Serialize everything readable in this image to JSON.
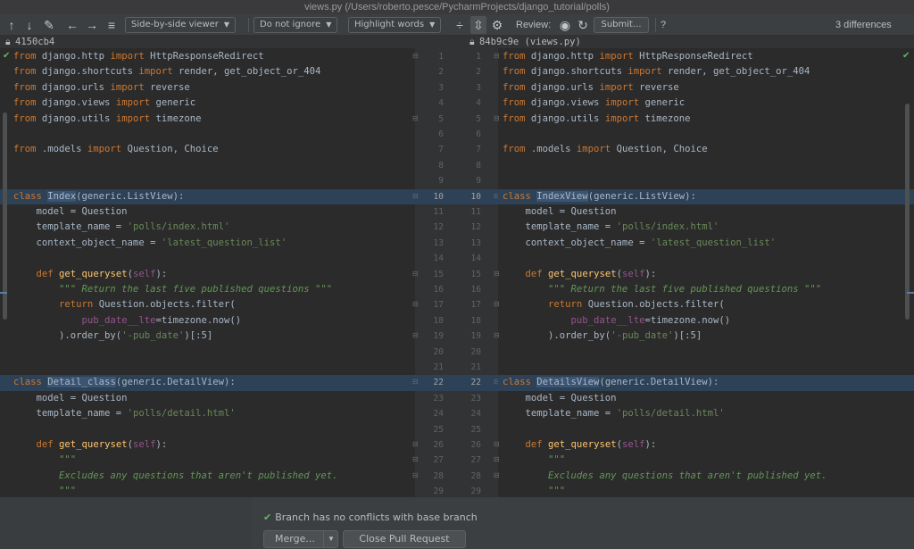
{
  "window": {
    "title": "views.py (/Users/roberto.pesce/PycharmProjects/django_tutorial/polls)"
  },
  "toolbar": {
    "viewer": "Side-by-side viewer",
    "ignore": "Do not ignore",
    "highlight": "Highlight words",
    "review_label": "Review:",
    "submit_label": "Submit...",
    "help": "?",
    "differences": "3 differences"
  },
  "revisions": {
    "left": "4150cb4",
    "right": "84b9c9e (views.py)"
  },
  "bottom": {
    "status": "Branch has no conflicts with base branch",
    "merge_label": "Merge...",
    "close_label": "Close Pull Request"
  },
  "lines_left": [
    "from django.http import HttpResponseRedirect",
    "from django.shortcuts import render, get_object_or_404",
    "from django.urls import reverse",
    "from django.views import generic",
    "from django.utils import timezone",
    "",
    "from .models import Question, Choice",
    "",
    "",
    "class Index(generic.ListView):",
    "    model = Question",
    "    template_name = 'polls/index.html'",
    "    context_object_name = 'latest_question_list'",
    "",
    "    def get_queryset(self):",
    "        \"\"\" Return the last five published questions \"\"\"",
    "        return Question.objects.filter(",
    "            pub_date__lte=timezone.now()",
    "        ).order_by('-pub_date')[:5]",
    "",
    "",
    "class Detail_class(generic.DetailView):",
    "    model = Question",
    "    template_name = 'polls/detail.html'",
    "",
    "    def get_queryset(self):",
    "        \"\"\"",
    "        Excludes any questions that aren't published yet.",
    "        \"\"\""
  ],
  "lines_right": [
    "from django.http import HttpResponseRedirect",
    "from django.shortcuts import render, get_object_or_404",
    "from django.urls import reverse",
    "from django.views import generic",
    "from django.utils import timezone",
    "",
    "from .models import Question, Choice",
    "",
    "",
    "class IndexView(generic.ListView):",
    "    model = Question",
    "    template_name = 'polls/index.html'",
    "    context_object_name = 'latest_question_list'",
    "",
    "    def get_queryset(self):",
    "        \"\"\" Return the last five published questions \"\"\"",
    "        return Question.objects.filter(",
    "            pub_date__lte=timezone.now()",
    "        ).order_by('-pub_date')[:5]",
    "",
    "",
    "class DetailsView(generic.DetailView):",
    "    model = Question",
    "    template_name = 'polls/detail.html'",
    "",
    "    def get_queryset(self):",
    "        \"\"\"",
    "        Excludes any questions that aren't published yet.",
    "        \"\"\""
  ],
  "changed_lines": [
    10,
    22
  ],
  "colors": {
    "changed_bg": "#2d4157",
    "keyword": "#cc7832",
    "string": "#6a8759",
    "docstring": "#629755"
  }
}
